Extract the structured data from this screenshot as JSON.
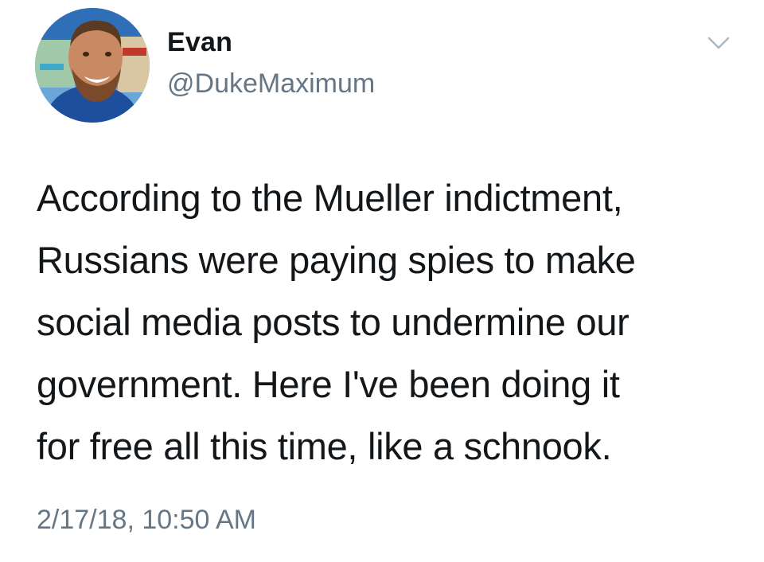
{
  "author": {
    "display_name": "Evan",
    "handle": "@DukeMaximum"
  },
  "icons": {
    "avatar": "profile-photo",
    "menu": "chevron-down-icon"
  },
  "tweet": {
    "lines": [
      "According to the Mueller indictment,",
      "Russians were paying spies to make",
      "social media posts to undermine our",
      "government. Here I've been doing it",
      "for free all this time, like a schnook."
    ],
    "timestamp": "2/17/18, 10:50 AM"
  },
  "colors": {
    "text": "#14171a",
    "secondary": "#657786",
    "chevron": "#aab8c2"
  }
}
